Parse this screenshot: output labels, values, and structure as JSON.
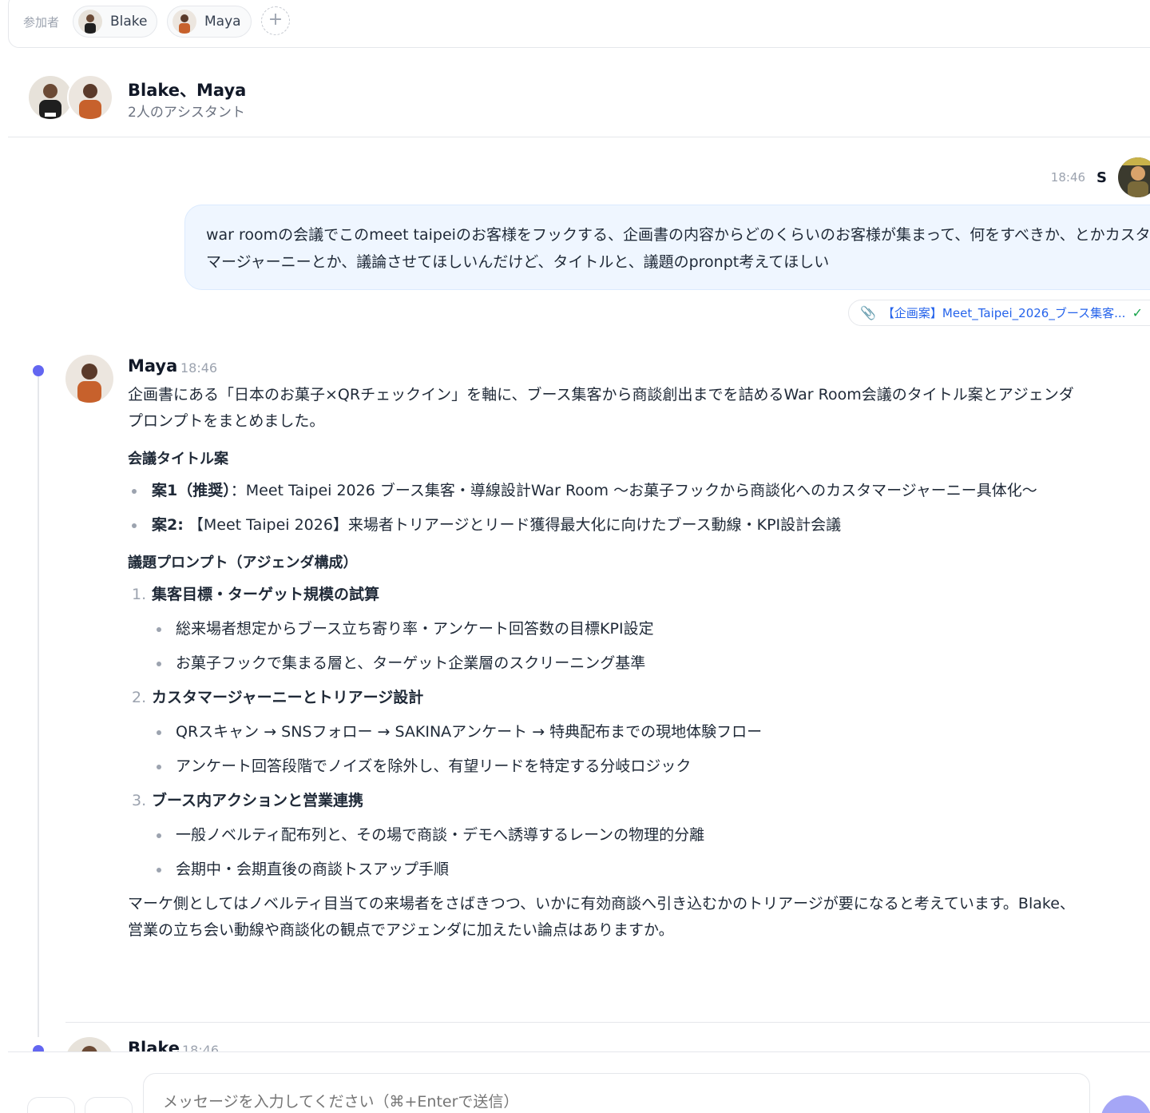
{
  "participants": {
    "label": "参加者",
    "items": [
      {
        "name": "Blake"
      },
      {
        "name": "Maya"
      }
    ],
    "add_label": "+"
  },
  "header": {
    "title": "Blake、Maya",
    "subtitle": "2人のアシスタント"
  },
  "user_message": {
    "time": "18:46",
    "name": "S",
    "text": "war roomの会議でこのmeet taipeiのお客様をフックする、企画書の内容からどのくらいのお客様が集まって、何をすべきか、とかカスタマージャーニーとか、議論させてほしいんだけど、タイトルと、議題のpronpt考えてほしい",
    "attachment": "【企画案】Meet_Taipei_2026_ブース集客...",
    "attachment_status": "✓"
  },
  "maya_message": {
    "name": "Maya",
    "time": "18:46",
    "intro": "企画書にある「日本のお菓子×QRチェックイン」を軸に、ブース集客から商談創出までを詰めるWar Room会議のタイトル案とアジェンダプロンプトをまとめました。",
    "titles_heading": "会議タイトル案",
    "titles": [
      {
        "label": "案1（推奨）",
        "text": "：Meet Taipei 2026 ブース集客・導線設計War Room 〜お菓子フックから商談化へのカスタマージャーニー具体化〜"
      },
      {
        "label": "案2:",
        "text": " 【Meet Taipei 2026】来場者トリアージとリード獲得最大化に向けたブース動線・KPI設計会議"
      }
    ],
    "agenda_heading": "議題プロンプト（アジェンダ構成）",
    "agenda": [
      {
        "num": "1.",
        "title": "集客目標・ターゲット規模の試算",
        "items": [
          "総来場者想定からブース立ち寄り率・アンケート回答数の目標KPI設定",
          "お菓子フックで集まる層と、ターゲット企業層のスクリーニング基準"
        ]
      },
      {
        "num": "2.",
        "title": "カスタマージャーニーとトリアージ設計",
        "items": [
          "QRスキャン → SNSフォロー → SAKINAアンケート → 特典配布までの現地体験フロー",
          "アンケート回答段階でノイズを除外し、有望リードを特定する分岐ロジック"
        ]
      },
      {
        "num": "3.",
        "title": "ブース内アクションと営業連携",
        "items": [
          "一般ノベルティ配布列と、その場で商談・デモへ誘導するレーンの物理的分離",
          "会期中・会期直後の商談トスアップ手順"
        ]
      }
    ],
    "closing": "マーケ側としてはノベルティ目当ての来場者をさばきつつ、いかに有効商談へ引き込むかのトリアージが要になると考えています。Blake、営業の立ち会い動線や商談化の観点でアジェンダに加えたい論点はありますか。"
  },
  "blake_message": {
    "name": "Blake",
    "time": "18:46"
  },
  "composer": {
    "placeholder": "メッセージを入力してください（⌘+Enterで送信）"
  },
  "colors": {
    "accent": "#6366f1",
    "bubble": "#eff6ff",
    "link": "#2563eb"
  }
}
